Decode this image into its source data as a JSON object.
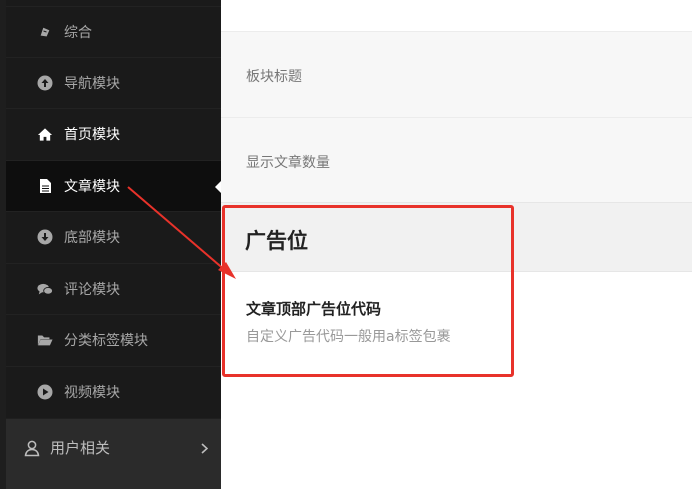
{
  "sidebar": {
    "items": [
      {
        "label": "综合",
        "icon": "settings-icon"
      },
      {
        "label": "导航模块",
        "icon": "arrow-up-circle-icon"
      },
      {
        "label": "首页模块",
        "icon": "home-icon"
      },
      {
        "label": "文章模块",
        "icon": "document-icon"
      },
      {
        "label": "底部模块",
        "icon": "arrow-down-circle-icon"
      },
      {
        "label": "评论模块",
        "icon": "comments-icon"
      },
      {
        "label": "分类标签模块",
        "icon": "folder-open-icon"
      },
      {
        "label": "视频模块",
        "icon": "play-circle-icon"
      }
    ],
    "parent": {
      "label": "用户相关",
      "icon": "user-icon"
    }
  },
  "main": {
    "rows": [
      {
        "label": "板块标题"
      },
      {
        "label": "显示文章数量"
      }
    ],
    "section": {
      "title": "广告位",
      "field_title": "文章顶部广告位代码",
      "field_desc": "自定义广告代码一般用a标签包裹"
    }
  },
  "colors": {
    "sidebar_bg": "#1a1a1a",
    "active_bg": "#0e0e0e",
    "annotation_red": "#e8322a"
  }
}
